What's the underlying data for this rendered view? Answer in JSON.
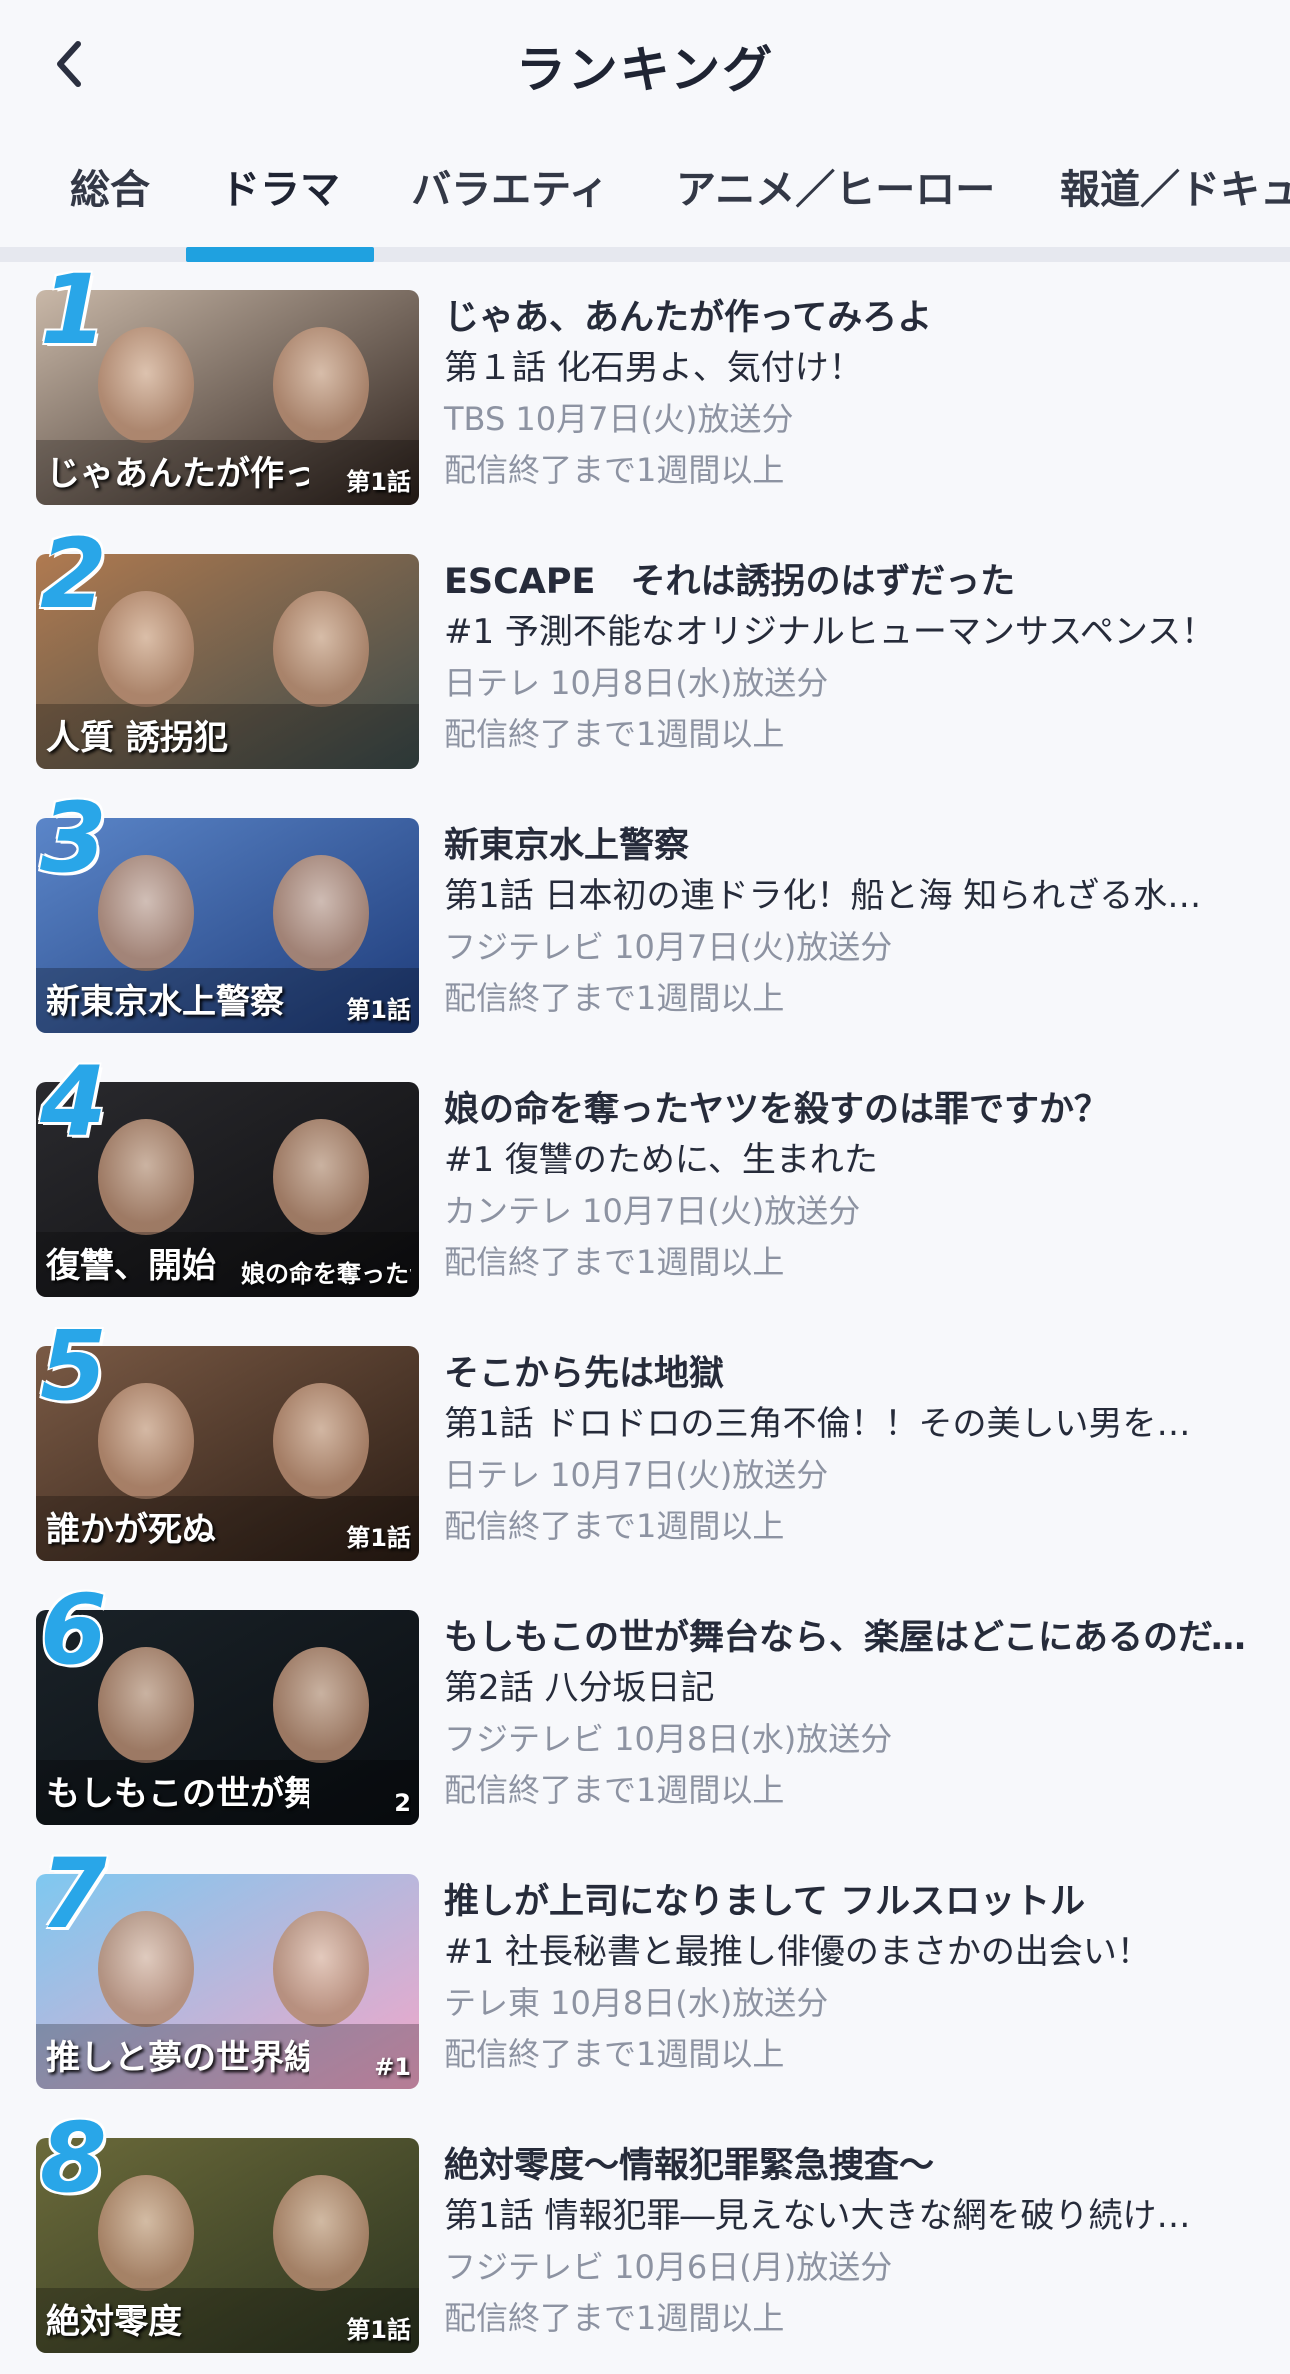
{
  "header": {
    "title": "ランキング",
    "back_icon": "chevron-left-icon"
  },
  "tabs": [
    {
      "label": "総合",
      "active": false
    },
    {
      "label": "ドラマ",
      "active": true
    },
    {
      "label": "バラエティ",
      "active": false
    },
    {
      "label": "アニメ／ヒーロー",
      "active": false
    },
    {
      "label": "報道／ドキュ",
      "active": false
    }
  ],
  "colors": {
    "accent": "#1fa1e0",
    "rank": "#29a6e8",
    "text": "#262b3a",
    "subtext": "#8d93a2",
    "background": "#f7f8fb"
  },
  "rankings": [
    {
      "rank": "1",
      "title": "じゃあ、あんたが作ってみろよ",
      "episode": "第１話 化石男よ、気付け！",
      "air": "TBS 10月7日(火)放送分",
      "availability": "配信終了まで1週間以上",
      "thumb_text": "じゃあんたが作ってみろよ",
      "thumb_badge": "第1話",
      "thumb_colors": [
        "#c9b8a8",
        "#2a1f1a"
      ]
    },
    {
      "rank": "2",
      "title": "ESCAPE　それは誘拐のはずだった",
      "episode": "#1 予測不能なオリジナルヒューマンサスペンス！",
      "air": "日テレ 10月8日(水)放送分",
      "availability": "配信終了まで1週間以上",
      "thumb_text": "人質 誘拐犯",
      "thumb_badge": "",
      "thumb_colors": [
        "#b07a50",
        "#3a4a4a"
      ]
    },
    {
      "rank": "3",
      "title": "新東京水上警察",
      "episode": "第1話 日本初の連ドラ化！船と海 知られざる水…",
      "air": "フジテレビ 10月7日(火)放送分",
      "availability": "配信終了まで1週間以上",
      "thumb_text": "新東京水上警察",
      "thumb_badge": "第1話",
      "thumb_colors": [
        "#5b86c9",
        "#1d3a78"
      ]
    },
    {
      "rank": "4",
      "title": "娘の命を奪ったヤツを殺すのは罪ですか？",
      "episode": "#1 復讐のために、生まれた",
      "air": "カンテレ 10月7日(火)放送分",
      "availability": "配信終了まで1週間以上",
      "thumb_text": "復讐、開始",
      "thumb_badge": "娘の命を奪ったヤツを殺すのは罪ですか？",
      "thumb_colors": [
        "#2a2a2e",
        "#0e0e10"
      ]
    },
    {
      "rank": "5",
      "title": "そこから先は地獄",
      "episode": "第1話 ドロドロの三角不倫！！その美しい男を…",
      "air": "日テレ 10月7日(火)放送分",
      "availability": "配信終了まで1週間以上",
      "thumb_text": "誰かが死ぬ",
      "thumb_badge": "第1話",
      "thumb_colors": [
        "#7a5a45",
        "#2a1c14"
      ]
    },
    {
      "rank": "6",
      "title": "もしもこの世が舞台なら、楽屋はどこにあるのだろう",
      "episode": "第2話 八分坂日記",
      "air": "フジテレビ 10月8日(水)放送分",
      "availability": "配信終了まで1週間以上",
      "thumb_text": "もしもこの世が舞台なら、楽屋はどこにあるのだろう",
      "thumb_badge": "2",
      "thumb_colors": [
        "#1a2228",
        "#0a0e12"
      ]
    },
    {
      "rank": "7",
      "title": "推しが上司になりまして フルスロットル",
      "episode": "#1 社長秘書と最推し俳優のまさかの出会い！",
      "air": "テレ東 10月8日(水)放送分",
      "availability": "配信終了まで1週間以上",
      "thumb_text": "推しと夢の世界線",
      "thumb_badge": "#1",
      "thumb_colors": [
        "#7ec8f0",
        "#f4a6c8"
      ]
    },
    {
      "rank": "8",
      "title": "絶対零度〜情報犯罪緊急捜査〜",
      "episode": "第1話 情報犯罪―見えない大きな網を破り続け…",
      "air": "フジテレビ 10月6日(月)放送分",
      "availability": "配信終了まで1週間以上",
      "thumb_text": "絶対零度",
      "thumb_badge": "第1話",
      "thumb_colors": [
        "#6b6a3a",
        "#2c3420"
      ]
    }
  ]
}
